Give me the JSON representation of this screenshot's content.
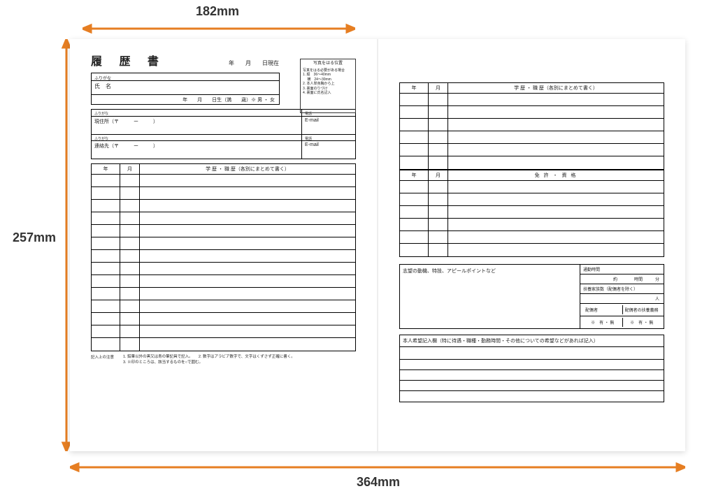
{
  "dimensions": {
    "top_width": "182mm",
    "side_height": "257mm",
    "bottom_width": "364mm"
  },
  "left_page": {
    "title": "履 歴 書",
    "date_suffix": "年　　月　　日現在",
    "photo_box": {
      "title": "写真をはる位置",
      "subtitle": "写真をはる必要がある場合",
      "line1": "1. 縦　36～40mm",
      "line2": "　 横　24～30mm",
      "line3": "2. 本人単身胸から上",
      "line4": "3. 裏面のりづけ",
      "line5": "4. 裏面に氏名記入"
    },
    "furigana1": "ふりがな",
    "name_label": "氏　名",
    "birth_line": "年　　月　　日生（満　　歳）※ 男 ・ 女",
    "furigana2": "ふりがな",
    "addr_label": "現住所（〒　　　ー　　　）",
    "tel_label": "電話",
    "email_label": "E-mail",
    "furigana3": "ふりがな",
    "contact_label": "連絡先（〒　　　ー　　　）",
    "tel2_label": "電話",
    "email2_label": "E-mail",
    "hist_header": {
      "y": "年",
      "m": "月",
      "t": "学 歴 ・ 職 歴（各別にまとめて書く）"
    },
    "notes_label": "記入上の注意",
    "notes_text1": "1. 鉛筆以外の黒又は青の筆記具で記入。　　2. 数字はアラビア数字で、文字はくずさず正確に書く。",
    "notes_text2": "3. ※印のところは、該当するものを○で囲む。"
  },
  "right_page": {
    "hist_header": {
      "y": "年",
      "m": "月",
      "t": "学 歴 ・ 職 歴（各別にまとめて書く）"
    },
    "lic_header": {
      "y": "年",
      "m": "月",
      "t": "免 許 ・ 資 格"
    },
    "motive_title": "志望の動機、特技、アピールポイントなど",
    "commute_label": "通勤時間",
    "commute_value": "約　　　　時間　　　分",
    "dependents_label": "扶養家族数（配偶者を除く）",
    "dependents_value": "人",
    "spouse_label": "配偶者",
    "spouse_duty_label": "配偶者の扶養義務",
    "yes_no1": "※　有 ・ 無",
    "yes_no2": "※　有 ・ 無",
    "wish_title": "本人希望記入欄（特に待遇・職種・勤務時間・その他についての希望などがあれば記入）"
  }
}
